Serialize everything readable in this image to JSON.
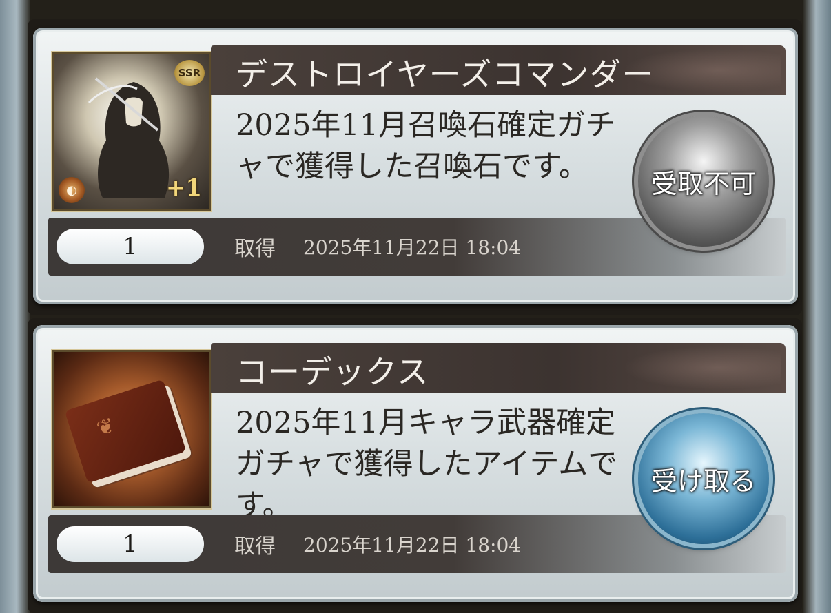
{
  "items": [
    {
      "name": "デストロイヤーズコマンダー",
      "description": "2025年11月召喚石確定ガチャで獲得した召喚石です。",
      "quantity": "1",
      "acquired_label": "取得",
      "acquired_date": "2025年11月22日 18:04",
      "rarity_badge": "SSR",
      "plus_badge": "+1",
      "button_label": "受取不可",
      "button_state": "disabled",
      "icon": "reaper-summon-icon"
    },
    {
      "name": "コーデックス",
      "description": "2025年11月キャラ武器確定ガチャで獲得したアイテムです。",
      "quantity": "1",
      "acquired_label": "取得",
      "acquired_date": "2025年11月22日 18:04",
      "button_label": "受け取る",
      "button_state": "enabled",
      "icon": "codex-book-icon"
    }
  ],
  "colors": {
    "title_bar": "#3c3330",
    "footer_bar": "#3d3937",
    "disabled_orb": "#8f8f8f",
    "enabled_orb": "#2d6f98"
  }
}
